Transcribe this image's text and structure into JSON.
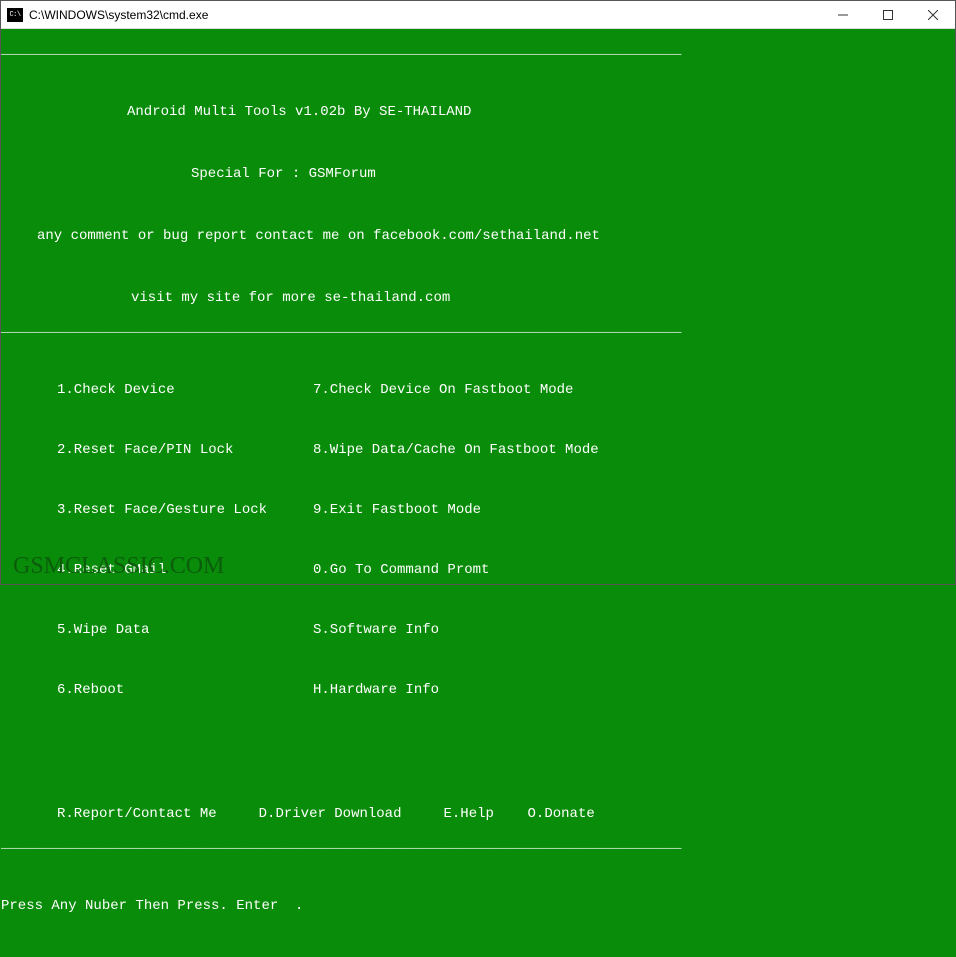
{
  "window": {
    "title": "C:\\WINDOWS\\system32\\cmd.exe"
  },
  "divider": "_________________________________________________________________________________",
  "header": {
    "l1": "Android Multi Tools v1.02b By SE-THAILAND",
    "l2": "Special For : GSMForum",
    "l3": "any comment or bug report contact me on facebook.com/sethailand.net",
    "l4": "visit my site for more se-thailand.com"
  },
  "menu": {
    "left": [
      "1.Check Device",
      "2.Reset Face/PIN Lock",
      "3.Reset Face/Gesture Lock",
      "4.Reset GMail",
      "5.Wipe Data",
      "6.Reboot"
    ],
    "right": [
      "7.Check Device On Fastboot Mode",
      "8.Wipe Data/Cache On Fastboot Mode",
      "9.Exit Fastboot Mode",
      "0.Go To Command Promt",
      "S.Software Info",
      "H.Hardware Info"
    ]
  },
  "footer": {
    "r": "R.Report/Contact Me",
    "d": "D.Driver Download",
    "e": "E.Help",
    "o": "O.Donate"
  },
  "prompt": "Press Any Nuber Then Press. Enter  .",
  "watermark": "GSMCLASSIC.COM"
}
